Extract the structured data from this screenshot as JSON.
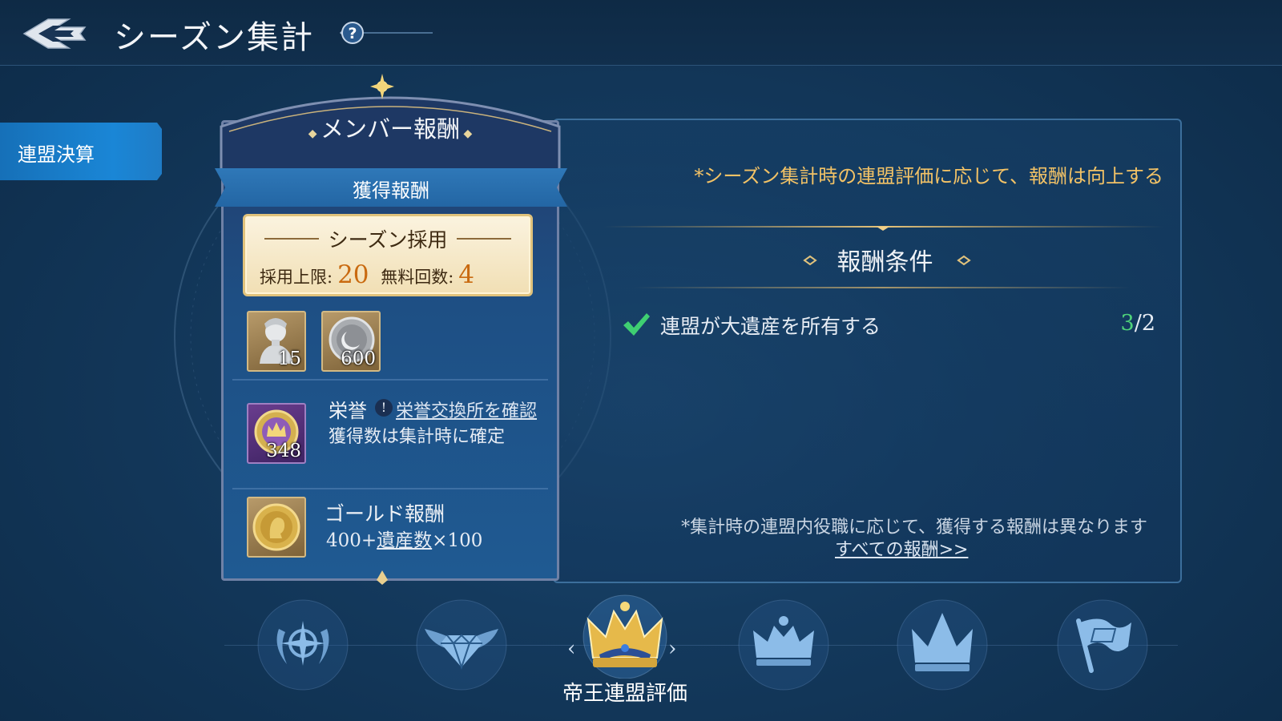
{
  "header": {
    "title": "シーズン集計"
  },
  "sidebar": {
    "tab_label": "連盟決算"
  },
  "card": {
    "header": "メンバー報酬",
    "ribbon": "獲得報酬",
    "season": {
      "title": "シーズン採用",
      "limit_label": "採用上限:",
      "limit_value": "20",
      "free_label": "無料回数:",
      "free_value": "4"
    },
    "items": [
      {
        "icon": "bust-statue-icon",
        "count": "15"
      },
      {
        "icon": "moon-coin-icon",
        "count": "600"
      }
    ],
    "honor": {
      "count": "348",
      "title": "栄誉",
      "link": "栄誉交換所を確認",
      "sub": "獲得数は集計時に確定"
    },
    "gold": {
      "title": "ゴールド報酬",
      "formula_prefix": "400+",
      "formula_link": "遺産数",
      "formula_suffix": "×100"
    }
  },
  "panel": {
    "note_top": "*シーズン集計時の連盟評価に応じて、報酬は向上する",
    "conditions_title": "報酬条件",
    "condition": {
      "text": "連盟が大遺産を所有する",
      "current": "3",
      "required": "/2"
    },
    "note_bottom": "*集計時の連盟内役職に応じて、獲得する報酬は異なります",
    "all_rewards_link": "すべての報酬>>"
  },
  "tiers": {
    "selected_label": "帝王連盟評価",
    "icons": [
      "compass-wreath-icon",
      "winged-diamond-icon",
      "gold-crown-icon",
      "small-crown-icon",
      "large-crown-icon",
      "flag-icon"
    ],
    "selected_index": 2
  },
  "colors": {
    "accent_gold": "#f2c266",
    "progress_green": "#4fd37a",
    "highlight_orange": "#c96a10",
    "tab_blue": "#1a86d6"
  }
}
